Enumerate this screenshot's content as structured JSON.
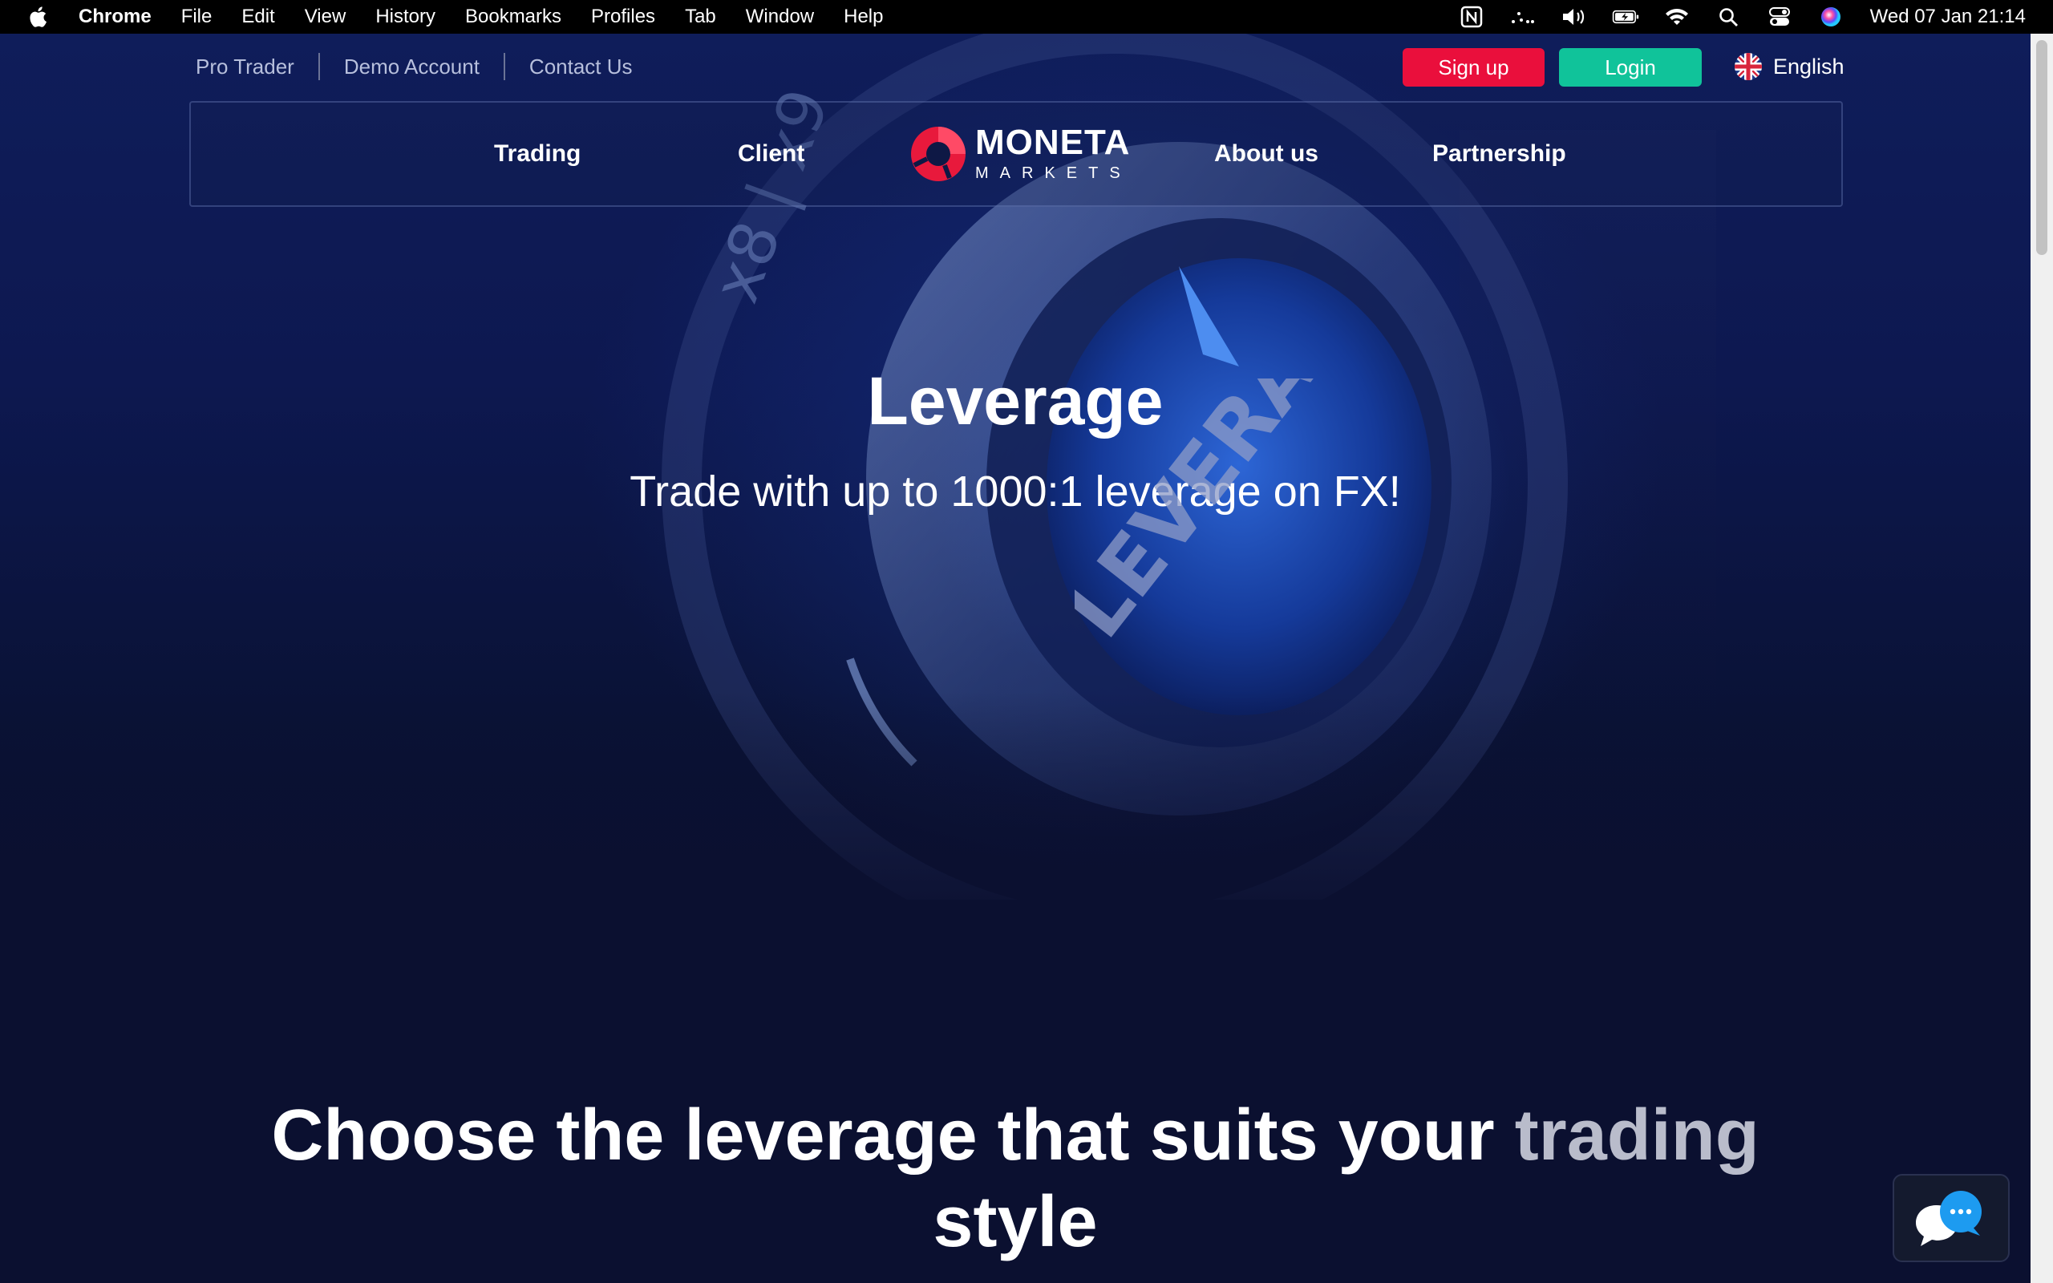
{
  "menubar": {
    "app": "Chrome",
    "items": [
      "File",
      "Edit",
      "View",
      "History",
      "Bookmarks",
      "Profiles",
      "Tab",
      "Window",
      "Help"
    ],
    "clock": "Wed 07 Jan  21:14"
  },
  "util_links": [
    "Pro Trader",
    "Demo Account",
    "Contact Us"
  ],
  "auth": {
    "signup": "Sign up",
    "login": "Login"
  },
  "language": "English",
  "nav": {
    "items": [
      "Trading",
      "Client",
      "About us",
      "Partnership"
    ]
  },
  "logo": {
    "top": "MONETA",
    "bottom": "MARKETS"
  },
  "hero": {
    "title": "Leverage",
    "subtitle": "Trade with up to 1000:1 leverage on FX!",
    "image_text": "LEVERAGE"
  },
  "section": {
    "title_main": "Choose the leverage that suits your ",
    "title_fade": "trading",
    "title_line2": "style"
  },
  "colors": {
    "signup": "#ea0f3c",
    "login": "#10c39a",
    "logo_red": "#e8193c"
  }
}
